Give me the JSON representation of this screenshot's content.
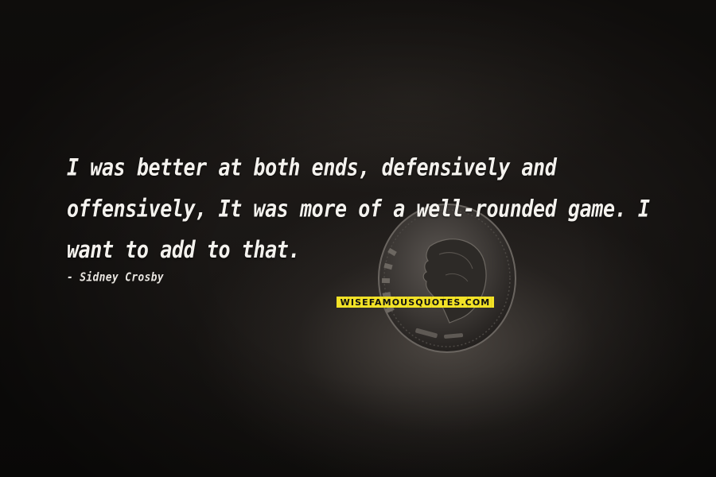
{
  "quote": {
    "text": "I was better at both ends, defensively and offensively, It was more of a well-rounded game. I want to add to that.",
    "author": "- Sidney Crosby"
  },
  "watermark": {
    "text": "WISEFAMOUSQUOTES.COM"
  },
  "colors": {
    "text": "#f4f2ee",
    "watermark_bg": "#f2e227",
    "background": "#1a1715"
  }
}
